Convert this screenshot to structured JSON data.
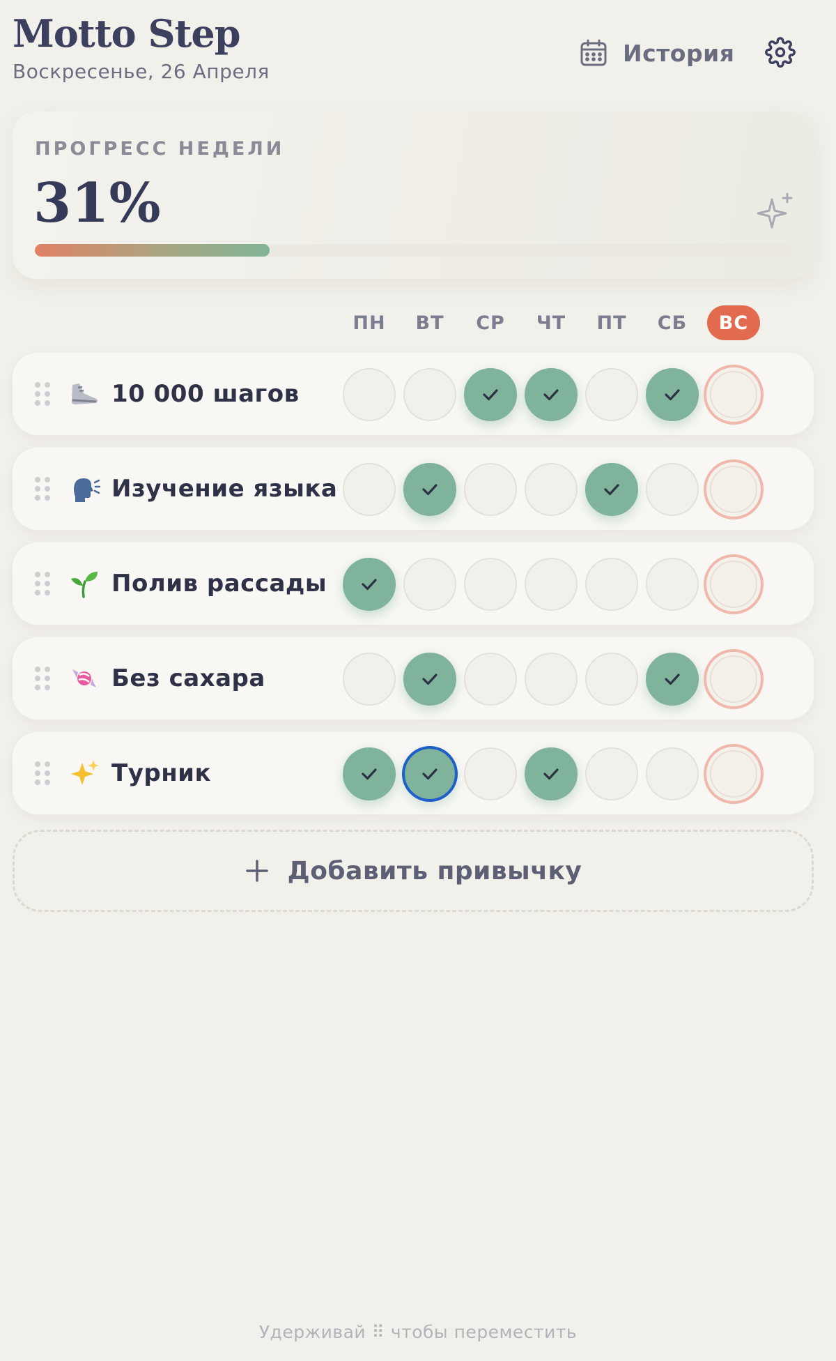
{
  "header": {
    "title": "Motto Step",
    "date": "Воскресенье, 26 Апреля",
    "history_label": "История"
  },
  "progress": {
    "label": "ПРОГРЕСС НЕДЕЛИ",
    "value_text": "31%",
    "fraction": 0.31
  },
  "days": [
    "ПН",
    "ВТ",
    "СР",
    "ЧТ",
    "ПТ",
    "СБ",
    "ВС"
  ],
  "today_index": 6,
  "habits": [
    {
      "name": "10 000 шагов",
      "icon": "sneaker-icon",
      "done": [
        false,
        false,
        true,
        true,
        false,
        true,
        false
      ]
    },
    {
      "name": "Изучение языка",
      "icon": "speaking-head-icon",
      "done": [
        false,
        true,
        false,
        false,
        true,
        false,
        false
      ]
    },
    {
      "name": "Полив рассады",
      "icon": "seedling-icon",
      "done": [
        true,
        false,
        false,
        false,
        false,
        false,
        false
      ]
    },
    {
      "name": "Без сахара",
      "icon": "candy-icon",
      "done": [
        false,
        true,
        false,
        false,
        false,
        true,
        false
      ]
    },
    {
      "name": "Турник",
      "icon": "sparkles-icon",
      "done": [
        true,
        true,
        false,
        true,
        false,
        false,
        false
      ]
    }
  ],
  "focused_cell": {
    "habit": 4,
    "day": 1
  },
  "add_habit_label": "Добавить привычку",
  "footer_hint": "Удерживай ⠿ чтобы переместить",
  "colors": {
    "accent": "#e26a4f",
    "done": "#7fb39b",
    "title": "#3c3f5e",
    "background": "#f2f0eb"
  }
}
